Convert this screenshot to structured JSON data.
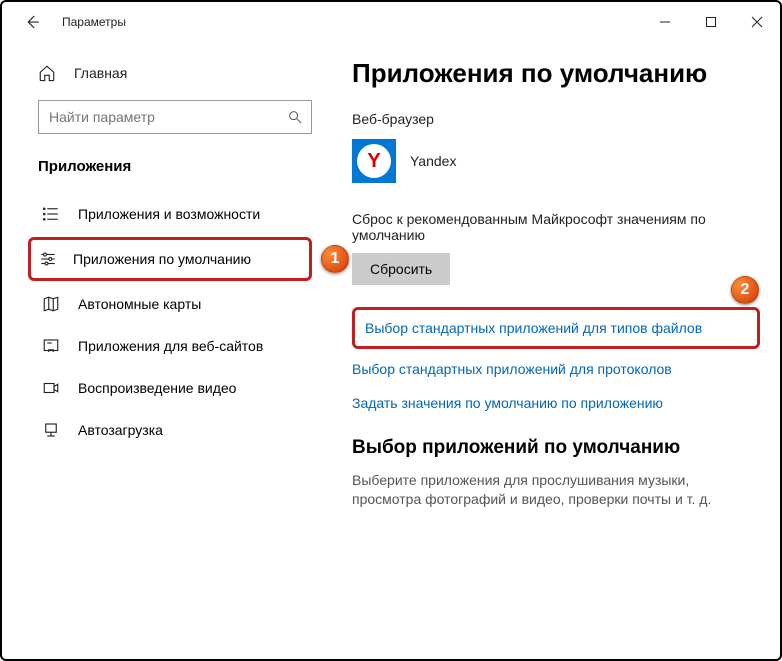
{
  "titlebar": {
    "title": "Параметры"
  },
  "sidebar": {
    "home": "Главная",
    "search_placeholder": "Найти параметр",
    "section": "Приложения",
    "items": [
      {
        "label": "Приложения и возможности"
      },
      {
        "label": "Приложения по умолчанию"
      },
      {
        "label": "Автономные карты"
      },
      {
        "label": "Приложения для веб-сайтов"
      },
      {
        "label": "Воспроизведение видео"
      },
      {
        "label": "Автозагрузка"
      }
    ]
  },
  "main": {
    "title": "Приложения по умолчанию",
    "browser_label": "Веб-браузер",
    "browser_app": "Yandex",
    "reset_desc": "Сброс к рекомендованным Майкрософт значениям по умолчанию",
    "reset_btn": "Сбросить",
    "link1": "Выбор стандартных приложений для типов файлов",
    "link2": "Выбор стандартных приложений для протоколов",
    "link3": "Задать значения по умолчанию по приложению",
    "section2_title": "Выбор приложений по умолчанию",
    "section2_desc": "Выберите приложения для прослушивания музыки, просмотра фотографий и видео, проверки почты и т. д."
  },
  "annotations": {
    "badge1": "1",
    "badge2": "2"
  }
}
